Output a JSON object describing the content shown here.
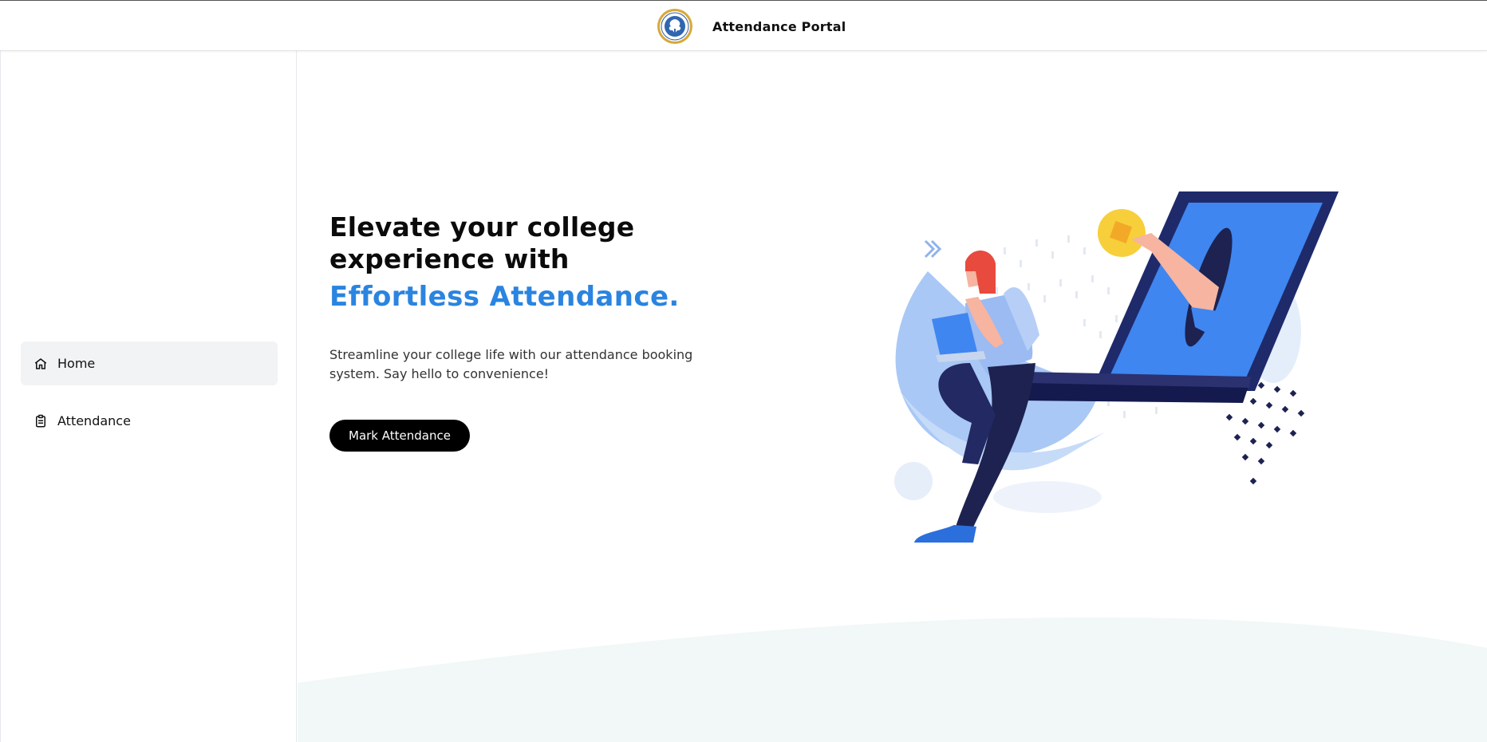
{
  "header": {
    "logo_icon": "college-seal-logo",
    "title": "Attendance Portal"
  },
  "sidebar": {
    "items": [
      {
        "label": "Home",
        "icon": "home-icon",
        "active": true
      },
      {
        "label": "Attendance",
        "icon": "clipboard-icon",
        "active": false
      }
    ]
  },
  "hero": {
    "headline_line1": "Elevate your college",
    "headline_line2": "experience with",
    "headline_accent": "Effortless Attendance.",
    "subtitle": "Streamline your college life with our attendance booking system. Say hello to convenience!",
    "cta_label": "Mark Attendance"
  },
  "colors": {
    "accent": "#2a84e0",
    "cta_background": "#000000",
    "sidebar_active": "#f2f3f5",
    "wave": "#f1f8f7"
  }
}
